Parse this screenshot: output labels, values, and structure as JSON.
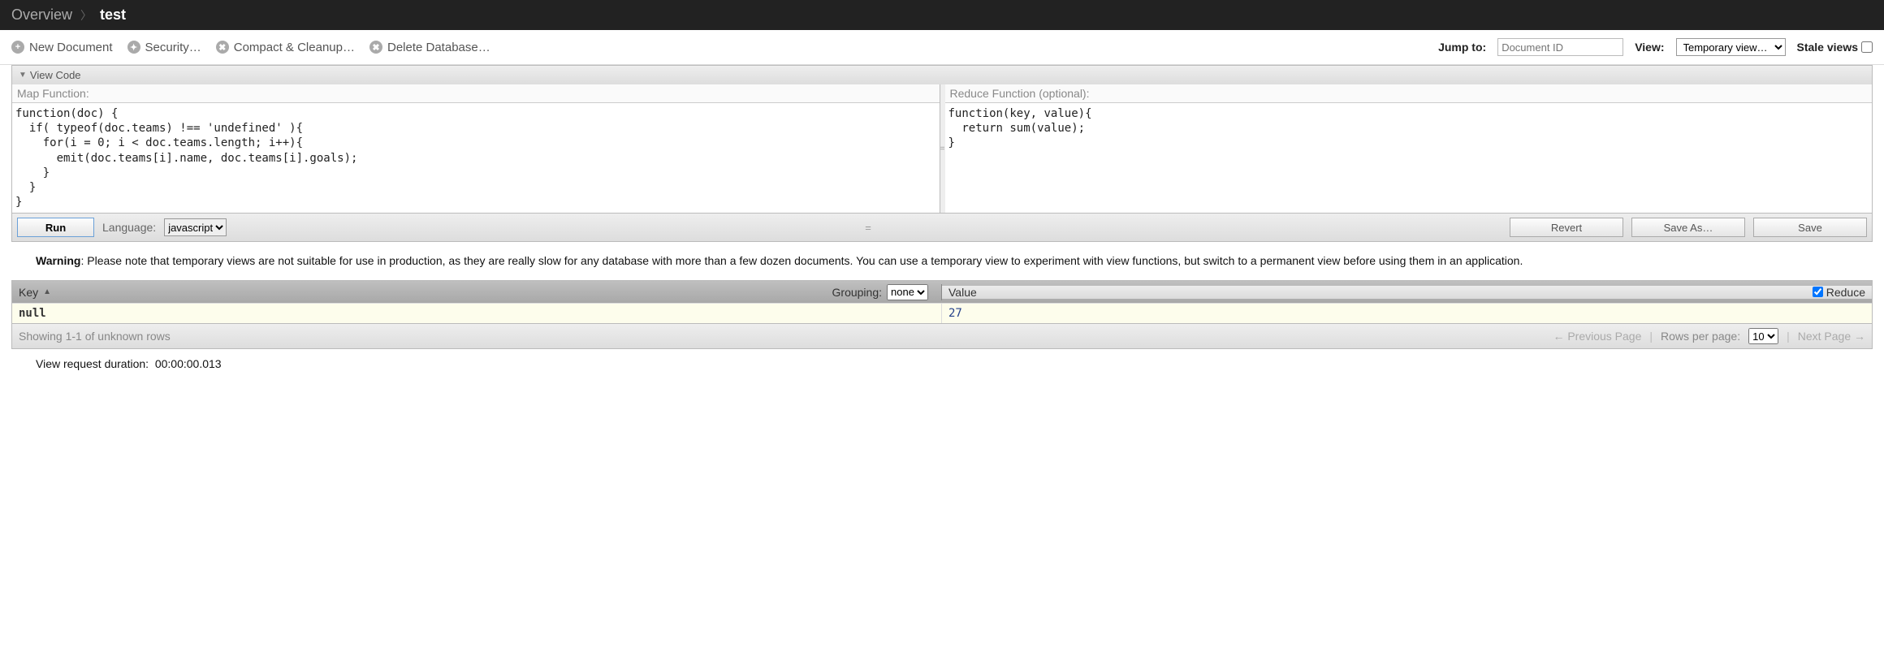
{
  "breadcrumb": {
    "root": "Overview",
    "current": "test"
  },
  "toolbar": {
    "new_doc": "New Document",
    "security": "Security…",
    "compact": "Compact & Cleanup…",
    "delete_db": "Delete Database…",
    "jump_label": "Jump to:",
    "jump_placeholder": "Document ID",
    "view_label": "View:",
    "view_selected": "Temporary view…",
    "stale_label": "Stale views"
  },
  "viewcode": {
    "header": "View Code",
    "map_title": "Map Function:",
    "map_body": "function(doc) {\n  if( typeof(doc.teams) !== 'undefined' ){\n    for(i = 0; i < doc.teams.length; i++){\n      emit(doc.teams[i].name, doc.teams[i].goals);\n    }\n  }\n}",
    "reduce_title": "Reduce Function (optional):",
    "reduce_body": "function(key, value){\n  return sum(value);\n}",
    "run": "Run",
    "language_label": "Language:",
    "language_value": "javascript",
    "revert": "Revert",
    "save_as": "Save As…",
    "save": "Save"
  },
  "warning": {
    "prefix": "Warning",
    "text": ": Please note that temporary views are not suitable for use in production, as they are really slow for any database with more than a few dozen documents. You can use a temporary view to experiment with view functions, but switch to a permanent view before using them in an application."
  },
  "results": {
    "key_header": "Key",
    "grouping_label": "Grouping:",
    "grouping_value": "none",
    "value_header": "Value",
    "reduce_label": "Reduce",
    "reduce_checked": true,
    "rows": [
      {
        "key": "null",
        "value": "27"
      }
    ],
    "showing": "Showing 1-1 of unknown rows",
    "prev": "← Previous Page",
    "rows_per_page_label": "Rows per page:",
    "rows_per_page_value": "10",
    "next": "Next Page →"
  },
  "duration": {
    "label": "View request duration:",
    "value": "00:00:00.013"
  }
}
